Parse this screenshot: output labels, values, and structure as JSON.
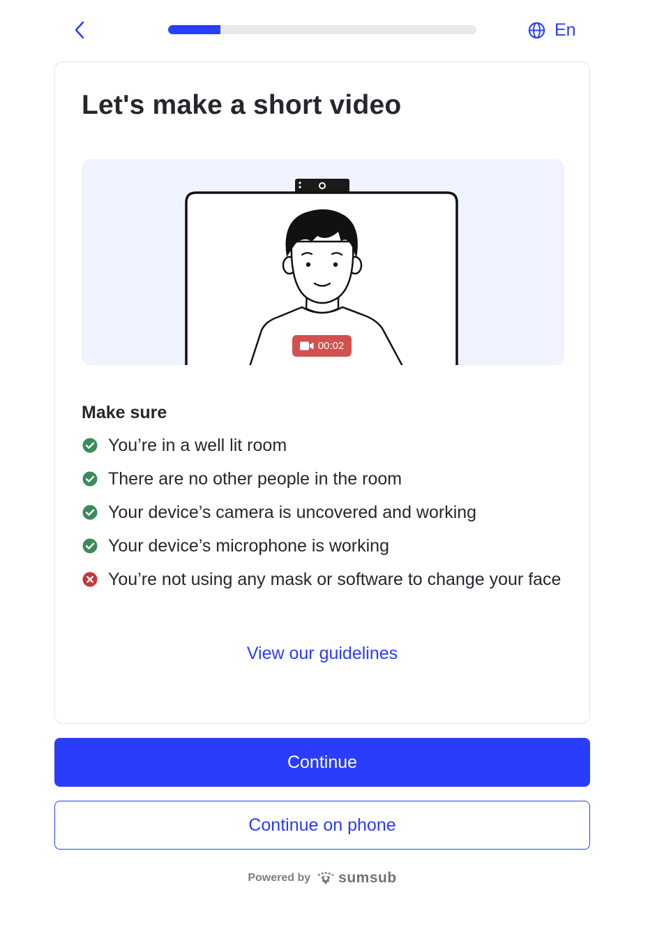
{
  "header": {
    "back_icon": "chevron-left-icon",
    "progress_fraction": 0.17,
    "language_icon": "globe-icon",
    "language_label": "En"
  },
  "card": {
    "title": "Let's make a short video",
    "illustration": {
      "recording_time": "00:02",
      "recording_icon": "video-camera-icon"
    },
    "make_sure_heading": "Make sure",
    "checklist": [
      {
        "text": "You’re in a well lit room",
        "status": "ok"
      },
      {
        "text": "There are no other people in the room",
        "status": "ok"
      },
      {
        "text": "Your device’s camera is uncovered and working",
        "status": "ok"
      },
      {
        "text": "Your device’s microphone is working",
        "status": "ok"
      },
      {
        "text": "You’re not using any mask or software to change your face",
        "status": "error"
      }
    ],
    "guidelines_link": "View our guidelines"
  },
  "actions": {
    "continue_label": "Continue",
    "continue_phone_label": "Continue on phone"
  },
  "footer": {
    "powered_by": "Powered by",
    "brand_name": "sumsub"
  },
  "colors": {
    "accent": "#2a3dfa",
    "ok_green": "#3d8a5a",
    "error_red": "#c9353a",
    "record_red": "#d2504f",
    "illustration_bg": "#eff3fd"
  }
}
